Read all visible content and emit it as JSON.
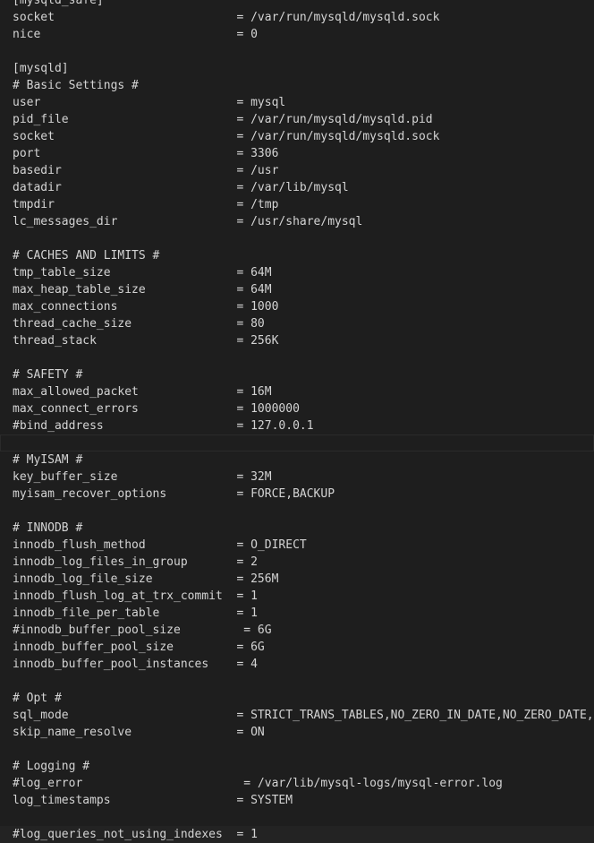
{
  "editor": {
    "lines": [
      "[mysqld_safe]",
      "socket                          = /var/run/mysqld/mysqld.sock",
      "nice                            = 0",
      "",
      "[mysqld]",
      "# Basic Settings #",
      "user                            = mysql",
      "pid_file                        = /var/run/mysqld/mysqld.pid",
      "socket                          = /var/run/mysqld/mysqld.sock",
      "port                            = 3306",
      "basedir                         = /usr",
      "datadir                         = /var/lib/mysql",
      "tmpdir                          = /tmp",
      "lc_messages_dir                 = /usr/share/mysql",
      "",
      "# CACHES AND LIMITS #",
      "tmp_table_size                  = 64M",
      "max_heap_table_size             = 64M",
      "max_connections                 = 1000",
      "thread_cache_size               = 80",
      "thread_stack                    = 256K",
      "",
      "# SAFETY #",
      "max_allowed_packet              = 16M",
      "max_connect_errors              = 1000000",
      "#bind_address                   = 127.0.0.1",
      "",
      "# MyISAM #",
      "key_buffer_size                 = 32M",
      "myisam_recover_options          = FORCE,BACKUP",
      "",
      "# INNODB #",
      "innodb_flush_method             = O_DIRECT",
      "innodb_log_files_in_group       = 2",
      "innodb_log_file_size            = 256M",
      "innodb_flush_log_at_trx_commit  = 1",
      "innodb_file_per_table           = 1",
      "#innodb_buffer_pool_size         = 6G",
      "innodb_buffer_pool_size         = 6G",
      "innodb_buffer_pool_instances    = 4",
      "",
      "# Opt #",
      "sql_mode                        = STRICT_TRANS_TABLES,NO_ZERO_IN_DATE,NO_ZERO_DATE,ERROR_FOR_DIVISION_BY_ZERO",
      "skip_name_resolve               = ON",
      "",
      "# Logging #",
      "#log_error                       = /var/lib/mysql-logs/mysql-error.log",
      "log_timestamps                  = SYSTEM",
      "",
      "#log_queries_not_using_indexes  = 1"
    ]
  }
}
